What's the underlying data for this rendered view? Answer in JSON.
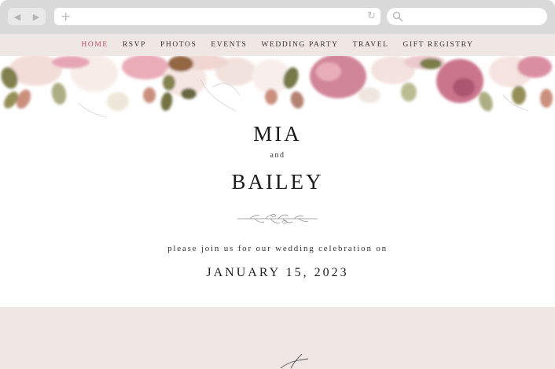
{
  "browser": {
    "back_icon": "◀",
    "forward_icon": "▶",
    "new_tab_icon": "+",
    "reload_icon": "↻"
  },
  "nav": {
    "items": [
      "HOME",
      "RSVP",
      "PHOTOS",
      "EVENTS",
      "WEDDING PARTY",
      "TRAVEL",
      "GIFT REGISTRY"
    ],
    "active_color": "#b5525f"
  },
  "hero": {
    "name1": "MIA",
    "and": "and",
    "name2": "BAILEY",
    "invite": "please join us for our wedding celebration on",
    "date": "JANUARY 15, 2023"
  },
  "colors": {
    "nav_bg": "#eee7e3",
    "chrome_bg": "#d9d9d9",
    "flower_pink": "#c9708a",
    "flower_blush": "#f1d3cf",
    "leaf_green": "#8a8a52"
  }
}
